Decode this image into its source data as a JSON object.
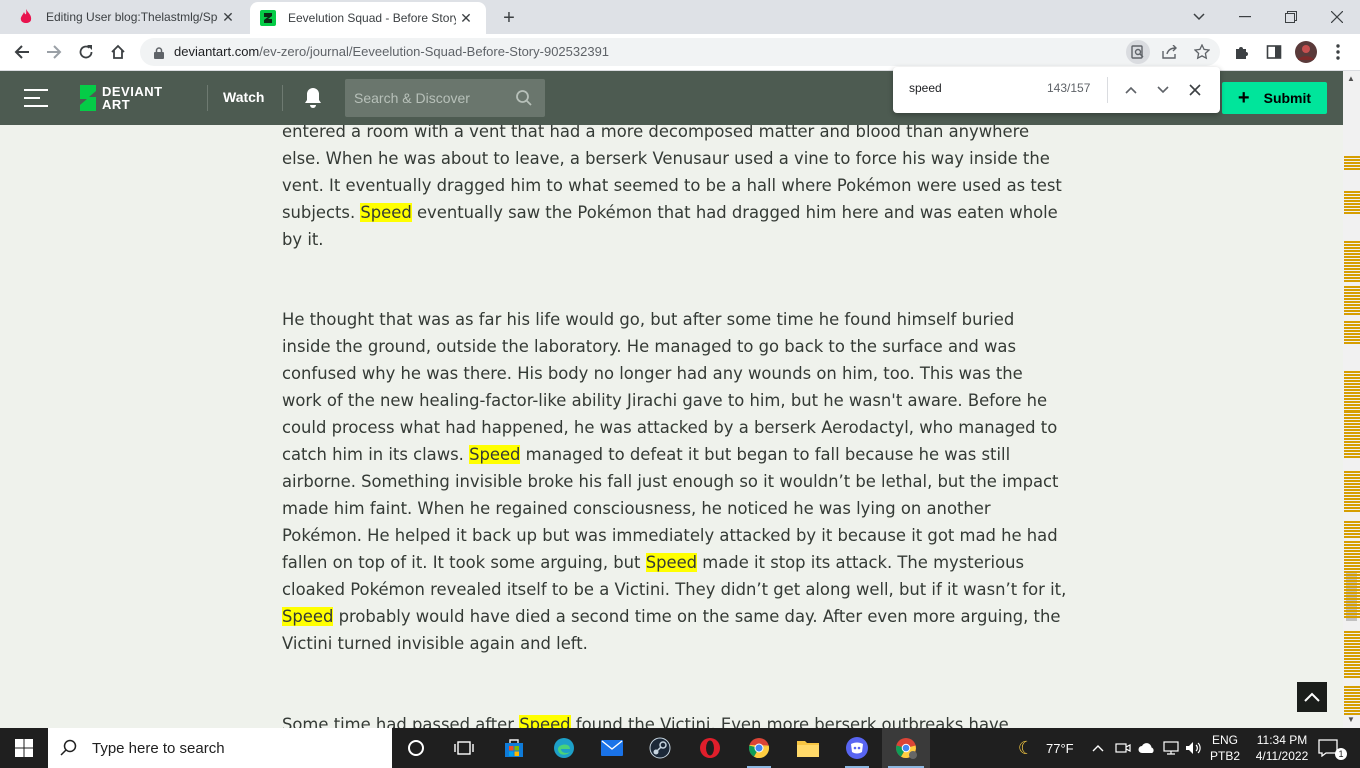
{
  "browser": {
    "tabs": [
      {
        "title": "Editing User blog:Thelastmlg/Spe",
        "active": false
      },
      {
        "title": "Eevelution Squad - Before Story",
        "active": true
      }
    ],
    "url_host": "deviantart.com",
    "url_path": "/ev-zero/journal/Eeveelution-Squad-Before-Story-902532391"
  },
  "find_bar": {
    "query": "speed",
    "count": "143/157"
  },
  "site_header": {
    "logo_text_1": "DEVIANT",
    "logo_text_2": "ART",
    "watch_label": "Watch",
    "search_placeholder": "Search & Discover",
    "submit_label": "Submit",
    "colors": {
      "header": "#4d5b51",
      "submit": "#00e59b",
      "highlight": "#ffff00"
    }
  },
  "article": {
    "p1": {
      "s1": "entered a room with a vent that had a more decomposed matter and blood than anywhere else. When he was about to leave, a berserk Venusaur used a vine to force his way inside the vent. It eventually dragged him to what seemed to be a hall where Pokémon were used as test subjects. ",
      "h1": "Speed",
      "s2": " eventually saw the Pokémon that had dragged him here and was eaten whole by it."
    },
    "p2": {
      "s1": "He thought that was as far his life would go, but after some time he found himself buried inside the ground, outside the laboratory. He managed to go back to the surface and was confused why he was there. His body no longer had any wounds on him, too. This was the work of the new healing-factor-like ability Jirachi gave to him, but he wasn't aware. Before he could process what had happened, he was attacked by a berserk Aerodactyl, who managed to catch him in its claws. ",
      "h1": "Speed",
      "s2": " managed to defeat it but began to fall because he was still airborne. Something invisible broke his fall just enough so it wouldn’t be lethal, but the impact made him faint. When he regained consciousness, he noticed he was lying on another Pokémon. He helped it back up but was immediately attacked by it because it got mad he had fallen on top of it. It took some arguing, but ",
      "h2": "Speed",
      "s3": " made it stop its attack. The mysterious cloaked Pokémon revealed itself to be a Victini. They didn’t get along well, but if it wasn’t for it, ",
      "h3": "Speed",
      "s4": " probably would have died a second time on the same day. After even more arguing, the Victini turned invisible again and left."
    },
    "p3": {
      "s1": "Some time had passed after ",
      "h1": "Speed",
      "s2": " found the Victini. Even more berserk outbreaks have"
    }
  },
  "taskbar": {
    "search_placeholder": "Type here to search",
    "weather": "77°F",
    "lang_1": "ENG",
    "lang_2": "PTB2",
    "time": "11:34 PM",
    "date": "4/11/2022",
    "notification_count": "1"
  }
}
